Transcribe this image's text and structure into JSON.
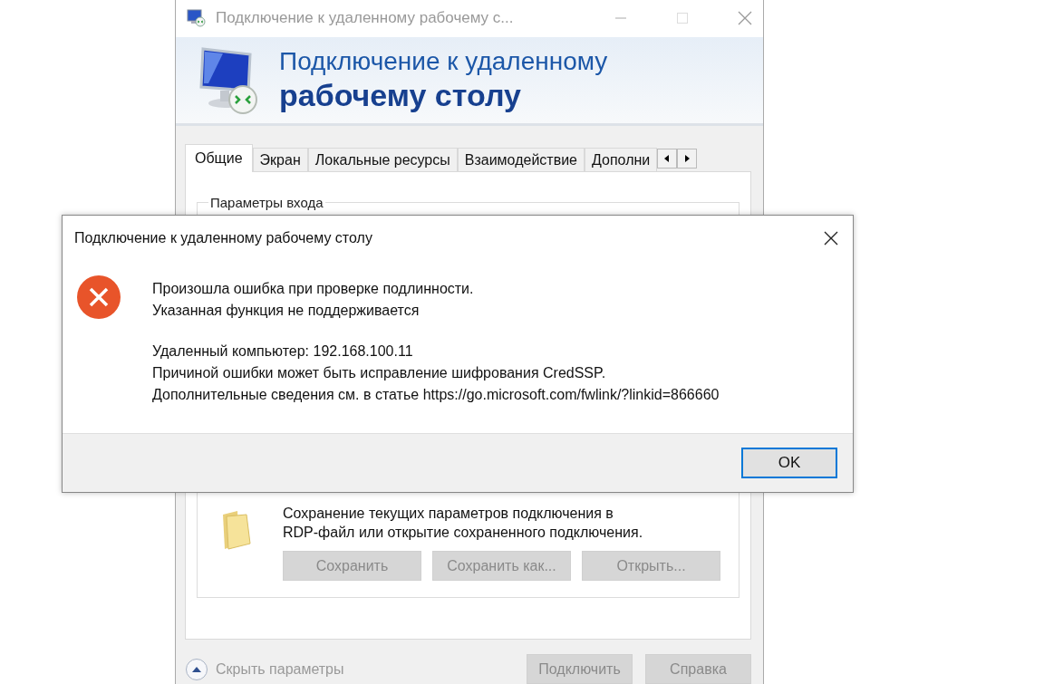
{
  "main_window": {
    "title": "Подключение к удаленному рабочему с...",
    "banner": {
      "line_1": "Подключение к удаленному",
      "line_2": "рабочему столу"
    },
    "tabs": [
      {
        "label": "Общие",
        "selected": true
      },
      {
        "label": "Экран",
        "selected": false
      },
      {
        "label": "Локальные ресурсы",
        "selected": false
      },
      {
        "label": "Взаимодействие",
        "selected": false
      },
      {
        "label": "Дополни",
        "selected": false
      }
    ],
    "login_group": {
      "title": "Параметры входа"
    },
    "save_group": {
      "description_lines": [
        "Сохранение текущих параметров подключения в",
        "RDP-файл или открытие сохраненного подключения."
      ],
      "buttons": [
        {
          "label": "Сохранить",
          "disabled": true
        },
        {
          "label": "Сохранить как...",
          "disabled": true
        },
        {
          "label": "Открыть...",
          "disabled": true
        }
      ]
    },
    "options_toggle": {
      "label": "Скрыть параметры",
      "disabled": true
    },
    "footer_buttons": [
      {
        "label": "Подключить",
        "disabled": true
      },
      {
        "label": "Справка",
        "disabled": true
      }
    ]
  },
  "error_dialog": {
    "title": "Подключение к удаленному рабочему столу",
    "message_lines": [
      "Произошла ошибка при проверке подлинности.",
      "Указанная функция не поддерживается"
    ],
    "detail_lines": [
      "Удаленный компьютер: 192.168.100.11",
      "Причиной ошибки может быть исправление шифрования CredSSP.",
      "Дополнительные сведения см. в статье https://go.microsoft.com/fwlink/?linkid=866660"
    ],
    "ok_button": {
      "label": "OK",
      "default": true
    }
  }
}
